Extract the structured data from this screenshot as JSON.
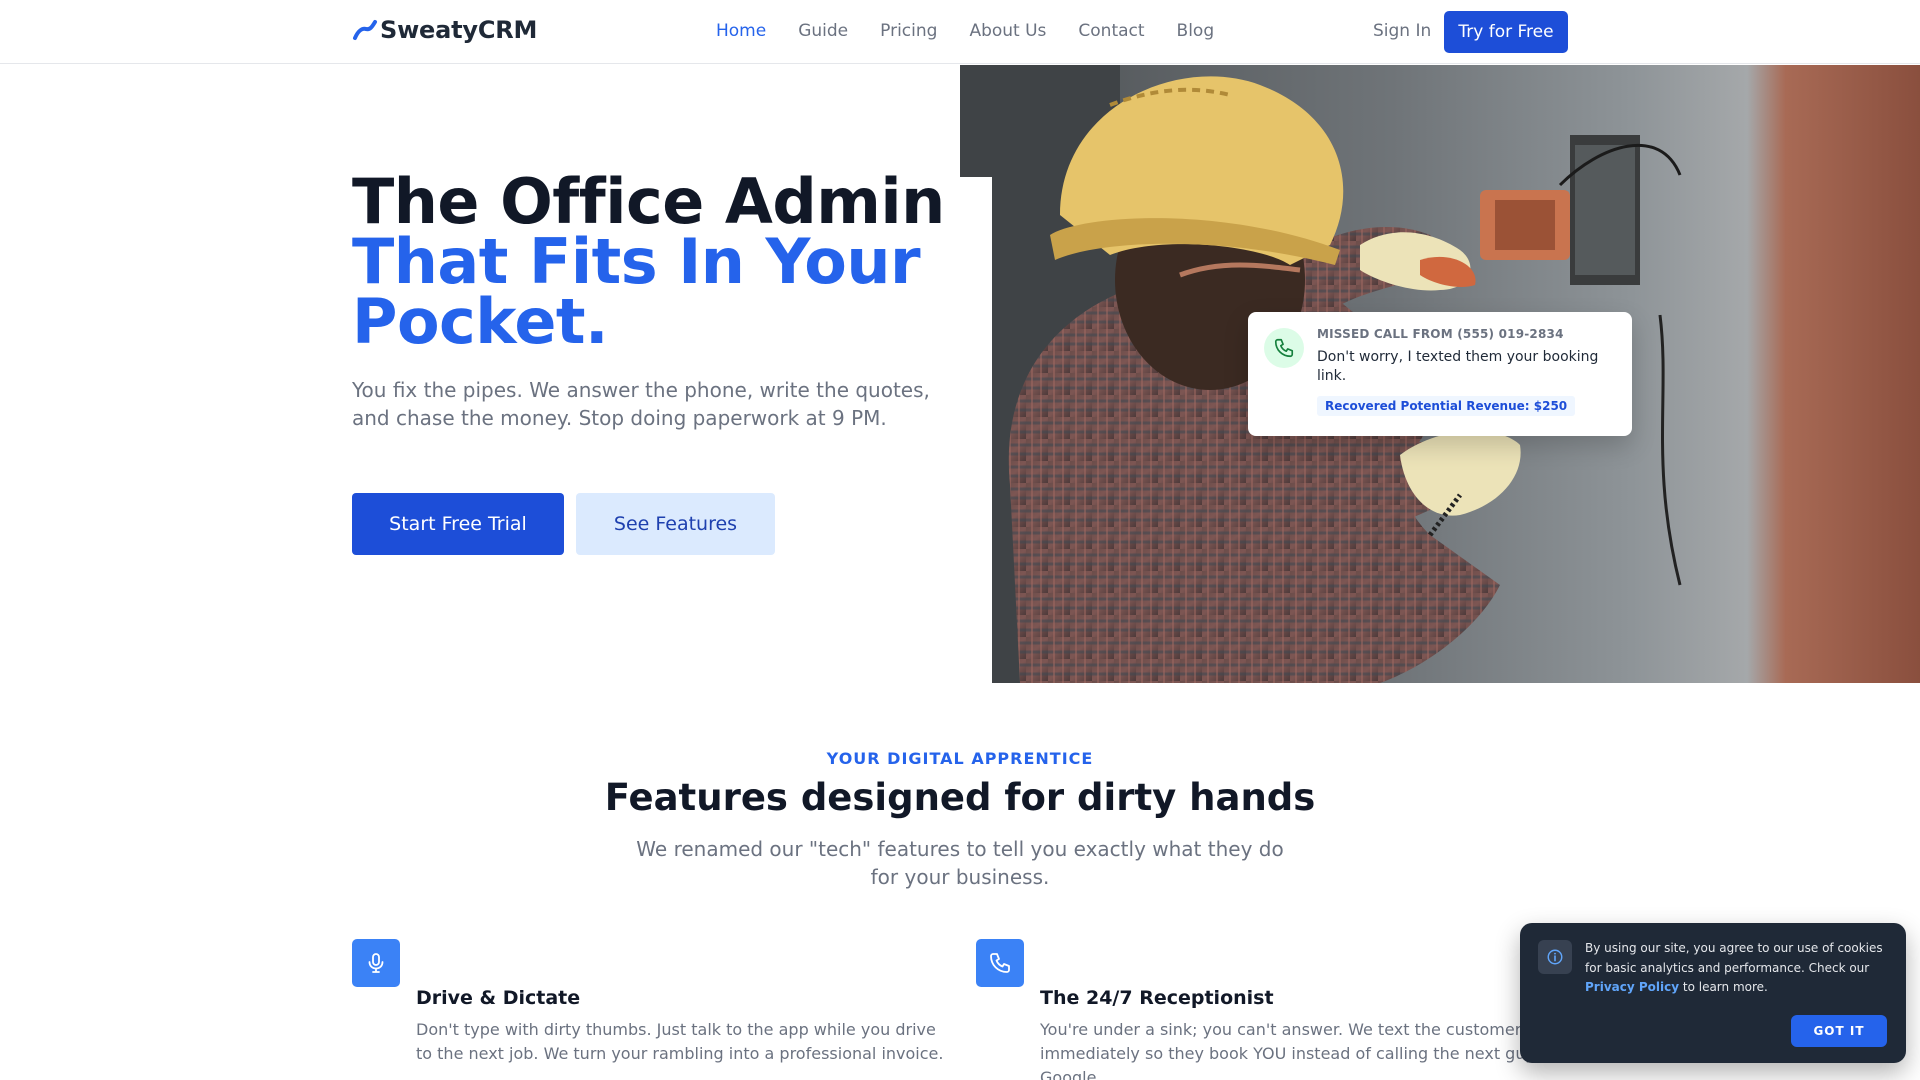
{
  "nav": {
    "brand": "SweatyCRM",
    "links": [
      {
        "label": "Home",
        "active": true
      },
      {
        "label": "Guide"
      },
      {
        "label": "Pricing"
      },
      {
        "label": "About Us"
      },
      {
        "label": "Contact"
      },
      {
        "label": "Blog"
      }
    ],
    "signin": "Sign In",
    "cta": "Try for Free"
  },
  "hero": {
    "title_line1": "The Office Admin",
    "title_line2": "That Fits In Your",
    "title_line3": "Pocket.",
    "subtitle": "You fix the pipes. We answer the phone, write the quotes, and chase the money. Stop doing paperwork at 9 PM.",
    "primary_button": "Start Free Trial",
    "secondary_button": "See Features"
  },
  "call_card": {
    "heading": "MISSED CALL FROM (555) 019-2834",
    "message": "Don't worry, I texted them your booking link.",
    "badge": "Recovered Potential Revenue: $250"
  },
  "features": {
    "eyebrow": "YOUR DIGITAL APPRENTICE",
    "title": "Features designed for dirty hands",
    "subtitle": "We renamed our \"tech\" features to tell you exactly what they do for your business.",
    "items": [
      {
        "icon": "microphone-icon",
        "name": "Drive & Dictate",
        "desc_line1": "Don't type with dirty thumbs. Just talk to the app while you drive",
        "desc_line2": "to the next job. We turn your rambling into a professional invoice."
      },
      {
        "icon": "phone-icon",
        "name": "The 24/7 Receptionist",
        "desc_line1": "You're under a sink; you can't answer. We text the customer",
        "desc_line2": "immediately so they book YOU instead of calling the next guy on",
        "desc_line3": "Google."
      }
    ]
  },
  "cookie": {
    "text_before": "By using our site, you agree to our use of cookies for basic analytics and performance. Check our ",
    "link": "Privacy Policy",
    "text_after": " to learn more.",
    "button": "GOT IT"
  },
  "colors": {
    "primary": "#1d4ed8",
    "accent": "#2563eb",
    "text_dark": "#111827",
    "text_muted": "#6b7280",
    "cookie_bg": "#1f2937"
  }
}
